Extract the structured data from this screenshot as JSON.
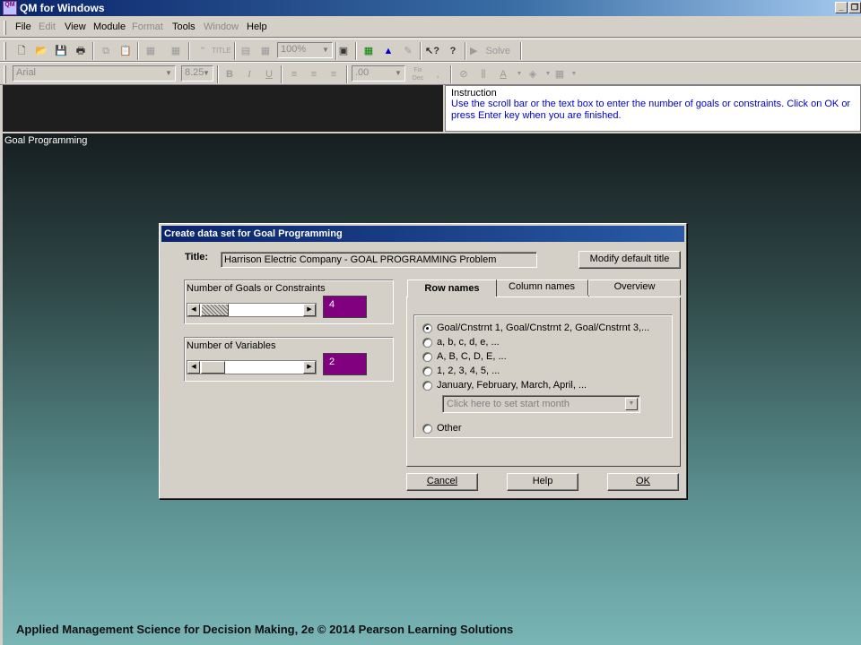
{
  "app": {
    "title": "QM for Windows",
    "icon_text": "QM",
    "window_controls": [
      "_",
      "❐"
    ]
  },
  "menu": [
    "File",
    "Edit",
    "View",
    "Module",
    "Format",
    "Tools",
    "Window",
    "Help"
  ],
  "toolbar1": {
    "zoom": "100%",
    "solve_label": "Solve",
    "icons": [
      "new-icon",
      "open-icon",
      "save-icon",
      "print-icon",
      "copy-icon",
      "paste-icon",
      "grid-icon",
      "grid-icon",
      "quote-icon",
      "title-icon",
      "table-icon",
      "table-icon",
      "zoom-select",
      "window-icon",
      "table-icon",
      "chart-icon",
      "edit-icon",
      "help-pointer-icon",
      "help-icon",
      "solve-icon"
    ]
  },
  "toolbar2": {
    "font": "Arial",
    "font_size": "8.25",
    "bold": "B",
    "italic": "I",
    "underline": "U",
    "number_format": ".00",
    "fix_dec": "Fix Dec"
  },
  "instruction": {
    "header": "Instruction",
    "text": "Use the scroll bar or the text box to enter the number of goals or constraints. Click on OK or press Enter key when you are finished."
  },
  "main": {
    "title": "Goal Programming"
  },
  "dialog": {
    "title": "Create data set for Goal Programming",
    "title_label": "Title:",
    "title_value": "Harrison Electric Company - GOAL PROGRAMMING Problem",
    "modify_button": "Modify default title",
    "goals_label": "Number of Goals or Constraints",
    "goals_value": "4",
    "variables_label": "Number of Variables",
    "variables_value": "2",
    "tabs": [
      "Row names",
      "Column names",
      "Overview"
    ],
    "options": [
      "Goal/Cnstrnt 1, Goal/Cnstrnt 2, Goal/Cnstrnt 3,...",
      "a, b, c, d, e, ...",
      "A, B, C, D, E, ...",
      "1, 2, 3, 4, 5, ...",
      "January, February, March, April, ..."
    ],
    "selected_option": 0,
    "month_placeholder": "Click here to set start month",
    "other_label": "Other",
    "buttons": {
      "cancel": "Cancel",
      "help": "Help",
      "ok": "OK"
    }
  },
  "footer": "Applied Management Science for Decision Making, 2e © 2014 Pearson Learning Solutions"
}
